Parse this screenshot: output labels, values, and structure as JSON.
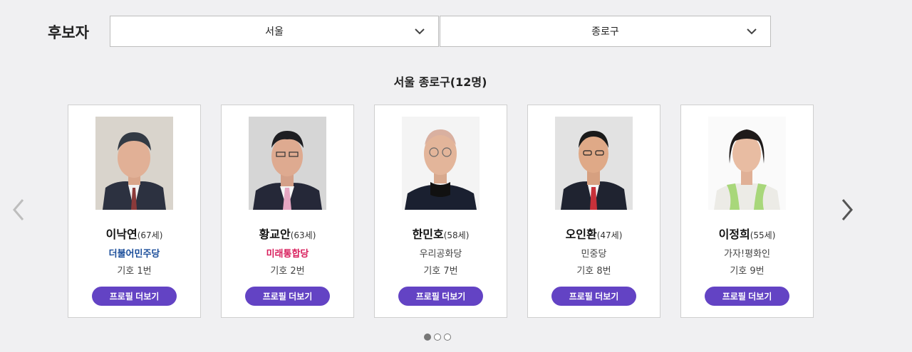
{
  "header": {
    "title": "후보자"
  },
  "filters": {
    "region": {
      "selected": "서울"
    },
    "district": {
      "selected": "종로구"
    }
  },
  "section": {
    "title": "서울 종로구(12명)"
  },
  "candidates": [
    {
      "name": "이낙연",
      "age": "(67세)",
      "party": "더불어민주당",
      "number": "기호 1번",
      "button": "프로필 더보기"
    },
    {
      "name": "황교안",
      "age": "(63세)",
      "party": "미래통합당",
      "number": "기호 2번",
      "button": "프로필 더보기"
    },
    {
      "name": "한민호",
      "age": "(58세)",
      "party": "우리공화당",
      "number": "기호 7번",
      "button": "프로필 더보기"
    },
    {
      "name": "오인환",
      "age": "(47세)",
      "party": "민중당",
      "number": "기호 8번",
      "button": "프로필 더보기"
    },
    {
      "name": "이정희",
      "age": "(55세)",
      "party": "가자!평화인",
      "number": "기호 9번",
      "button": "프로필 더보기"
    }
  ],
  "pagination": {
    "pages": 3,
    "current": 1
  },
  "colors": {
    "button": "#6343c4",
    "party_dem_blue": "#1a4d9a",
    "party_dem_green": "#27a24d",
    "party_ut_pink": "#d81d5b"
  },
  "icons": {
    "prev": "chevron-left-icon",
    "next": "chevron-right-icon",
    "dropdown": "chevron-down-icon"
  }
}
